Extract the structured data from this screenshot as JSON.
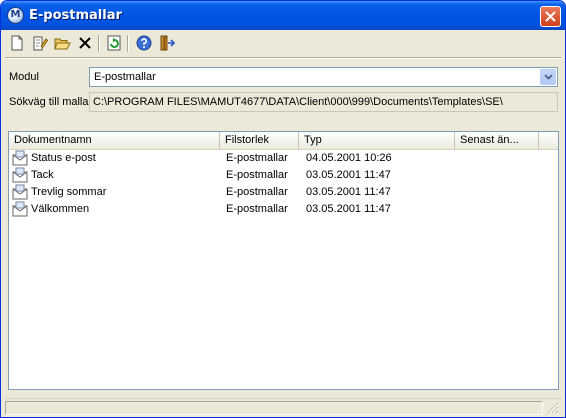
{
  "window": {
    "title": "E-postmallar",
    "app_icon_letter": "M"
  },
  "toolbar": {
    "buttons": [
      {
        "name": "new-icon"
      },
      {
        "name": "edit-icon"
      },
      {
        "name": "open-folder-icon"
      },
      {
        "name": "delete-icon"
      },
      {
        "name": "refresh-icon"
      },
      {
        "name": "help-icon"
      },
      {
        "name": "exit-icon"
      }
    ]
  },
  "form": {
    "modul_label": "Modul",
    "modul_value": "E-postmallar",
    "path_label": "Sökväg till mallar",
    "path_value": "C:\\PROGRAM FILES\\MAMUT4677\\DATA\\Client\\000\\999\\Documents\\Templates\\SE\\"
  },
  "list": {
    "columns": [
      "Dokumentnamn",
      "Filstorlek",
      "Typ",
      "Senast än..."
    ],
    "rows": [
      {
        "name": "Status e-post",
        "size": "E-postmallar",
        "type": "04.05.2001 10:26",
        "modified": ""
      },
      {
        "name": "Tack",
        "size": "E-postmallar",
        "type": "03.05.2001 11:47",
        "modified": ""
      },
      {
        "name": "Trevlig sommar",
        "size": "E-postmallar",
        "type": "03.05.2001 11:47",
        "modified": ""
      },
      {
        "name": "Välkommen",
        "size": "E-postmallar",
        "type": "03.05.2001 11:47",
        "modified": ""
      }
    ]
  },
  "colors": {
    "titlebar": "#0055e5",
    "window_bg": "#ece9d8",
    "field_border": "#7f9db9"
  }
}
